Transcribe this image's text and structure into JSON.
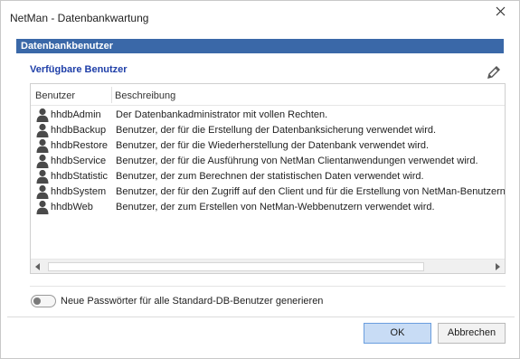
{
  "window": {
    "title": "NetMan - Datenbankwartung",
    "close_icon": "close-icon"
  },
  "section": {
    "title": "Datenbankbenutzer",
    "color": "#3a68a8"
  },
  "group": {
    "title": "Verfügbare Benutzer",
    "title_color": "#1f3fa8",
    "edit_icon": "pencil-icon"
  },
  "list": {
    "columns": [
      "Benutzer",
      "Beschreibung"
    ],
    "rows": [
      {
        "user": "hhdbAdmin",
        "description": "Der Datenbankadministrator mit vollen Rechten."
      },
      {
        "user": "hhdbBackup",
        "description": "Benutzer, der für die Erstellung der Datenbanksicherung verwendet wird."
      },
      {
        "user": "hhdbRestore",
        "description": "Benutzer, der für die Wiederherstellung der Datenbank verwendet wird."
      },
      {
        "user": "hhdbService",
        "description": "Benutzer, der für die Ausführung von NetMan Clientanwendungen verwendet wird."
      },
      {
        "user": "hhdbStatistic",
        "description": "Benutzer, der zum Berechnen der statistischen Daten verwendet wird."
      },
      {
        "user": "hhdbSystem",
        "description": "Benutzer, der für den Zugriff auf den Client und für die Erstellung von NetMan-Benutzern"
      },
      {
        "user": "hhdbWeb",
        "description": "Benutzer, der zum Erstellen von NetMan-Webbenutzern verwendet wird."
      }
    ],
    "row_icon": "user-icon"
  },
  "toggle": {
    "label": "Neue Passwörter für alle Standard-DB-Benutzer generieren",
    "checked": false
  },
  "buttons": {
    "ok": "OK",
    "cancel": "Abbrechen",
    "ok_color": "#c8dcf5"
  }
}
